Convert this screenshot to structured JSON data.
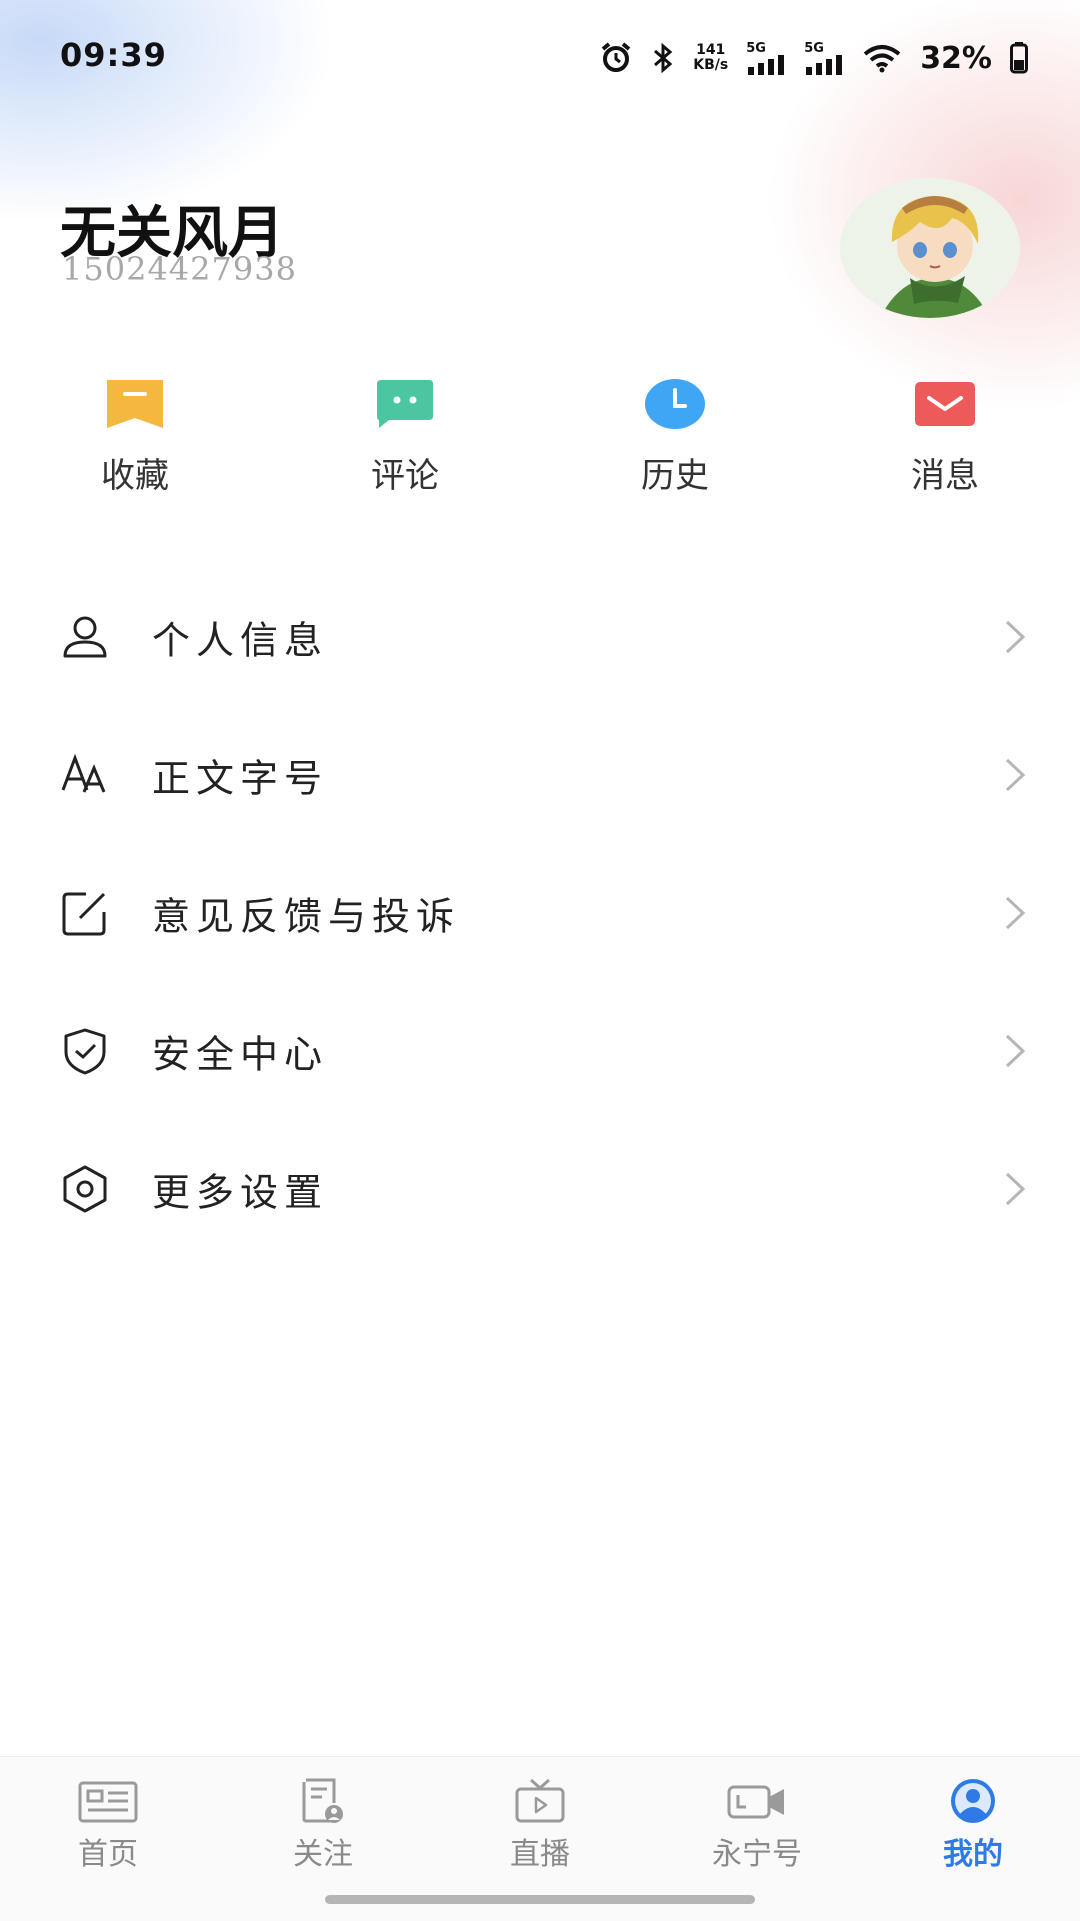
{
  "status_bar": {
    "time": "09:39",
    "net_speed_value": "141",
    "net_speed_unit": "KB/s",
    "signal_1": "5G",
    "signal_2": "5G",
    "battery": "32%"
  },
  "profile": {
    "name": "无关风月",
    "phone": "15024427938"
  },
  "quick_actions": [
    {
      "label": "收藏",
      "icon": "bookmark-icon",
      "color": "#F4B73F"
    },
    {
      "label": "评论",
      "icon": "comment-icon",
      "color": "#4CC6A0"
    },
    {
      "label": "历史",
      "icon": "clock-icon",
      "color": "#3FA5F5"
    },
    {
      "label": "消息",
      "icon": "mail-icon",
      "color": "#EE5A5A"
    }
  ],
  "menu": [
    {
      "label": "个人信息",
      "icon": "user-icon"
    },
    {
      "label": "正文字号",
      "icon": "font-size-icon"
    },
    {
      "label": "意见反馈与投诉",
      "icon": "edit-icon"
    },
    {
      "label": "安全中心",
      "icon": "shield-icon"
    },
    {
      "label": "更多设置",
      "icon": "settings-icon"
    }
  ],
  "tabs": [
    {
      "label": "首页",
      "icon": "news-icon",
      "active": false
    },
    {
      "label": "关注",
      "icon": "follow-icon",
      "active": false
    },
    {
      "label": "直播",
      "icon": "tv-icon",
      "active": false
    },
    {
      "label": "永宁号",
      "icon": "video-camera-icon",
      "active": false
    },
    {
      "label": "我的",
      "icon": "profile-icon",
      "active": true
    }
  ],
  "colors": {
    "accent": "#2F7BE6",
    "inactive_tab": "#8A8A8A"
  }
}
